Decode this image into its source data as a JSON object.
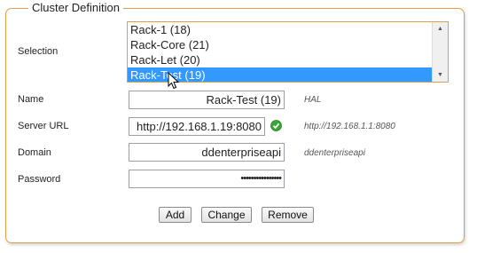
{
  "legend": "Cluster Definition",
  "selection": {
    "label": "Selection",
    "options": [
      "Rack-1 (18)",
      "Rack-Core (21)",
      "Rack-Let (20)",
      "Rack-Test (19)"
    ],
    "selected": "Rack-Test (19)"
  },
  "name": {
    "label": "Name",
    "value": "Rack-Test (19)",
    "hint": "HAL"
  },
  "server_url": {
    "label": "Server URL",
    "value": "http://192.168.1.19:8080",
    "hint": "http://192.168.1.1:8080",
    "status_icon": "check-circle-icon",
    "status_color": "#3aa635"
  },
  "domain": {
    "label": "Domain",
    "value": "ddenterpriseapi",
    "hint": "ddenterpriseapi"
  },
  "password": {
    "label": "Password",
    "value": "••••••••••••••••"
  },
  "buttons": {
    "add": "Add",
    "change": "Change",
    "remove": "Remove"
  },
  "colors": {
    "accent": "#e0a04a",
    "selection": "#3399ff"
  }
}
